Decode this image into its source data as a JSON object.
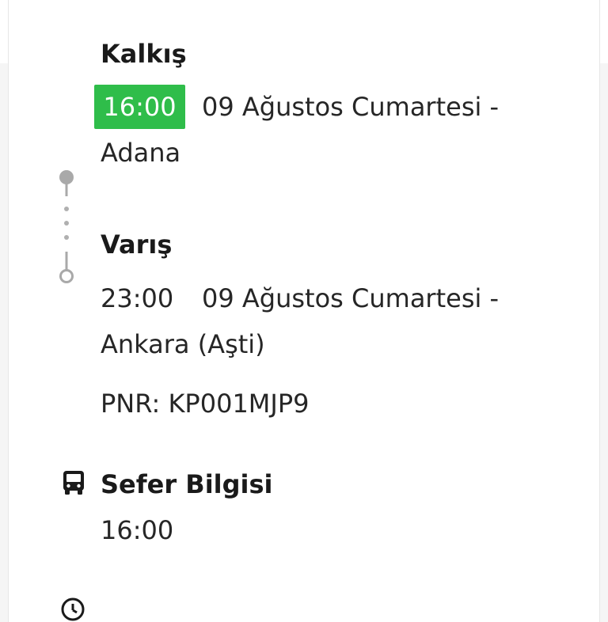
{
  "departure": {
    "heading": "Kalkış",
    "time": "16:00",
    "date": "09 Ağustos Cumartesi -",
    "city": "Adana"
  },
  "arrival": {
    "heading": "Varış",
    "time": "23:00",
    "date": "09 Ağustos Cumartesi -",
    "city": "Ankara (Aşti)"
  },
  "pnr": "PNR: KP001MJP9",
  "trip_info": {
    "heading": "Sefer Bilgisi",
    "value": "16:00",
    "icon": "bus-icon"
  },
  "next_section": {
    "icon": "clock-icon"
  },
  "colors": {
    "time_badge": "#2fbd4a",
    "connector": "#a9a9a9",
    "text": "#1a1a1a"
  }
}
